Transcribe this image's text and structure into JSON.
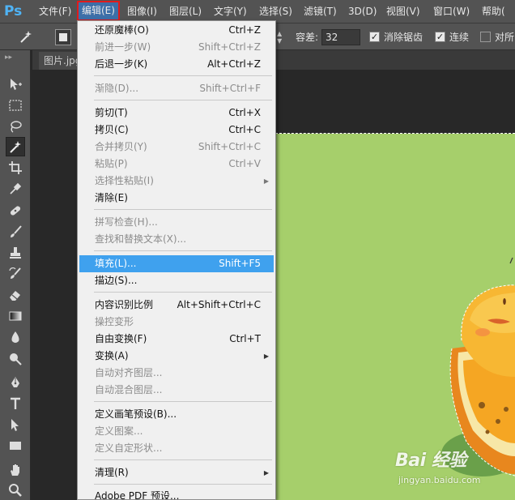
{
  "app": {
    "logo": "Ps",
    "menus": [
      "文件(F)",
      "编辑(E)",
      "图像(I)",
      "图层(L)",
      "文字(Y)",
      "选择(S)",
      "滤镜(T)",
      "3D(D)",
      "视图(V)",
      "窗口(W)",
      "帮助("
    ],
    "active_menu": "编辑(E)"
  },
  "options": {
    "tolerance_label": "容差:",
    "tolerance_value": "32",
    "antialias_label": "消除锯齿",
    "antialias_checked": true,
    "contiguous_label": "连续",
    "contiguous_checked": true,
    "sample_all_label": "对所",
    "sample_all_checked": false
  },
  "document": {
    "tab_title": "图片.jpg"
  },
  "edit_menu": {
    "items": [
      {
        "label": "还原魔棒(O)",
        "shortcut": "Ctrl+Z",
        "enabled": true
      },
      {
        "label": "前进一步(W)",
        "shortcut": "Shift+Ctrl+Z",
        "enabled": false
      },
      {
        "label": "后退一步(K)",
        "shortcut": "Alt+Ctrl+Z",
        "enabled": true
      },
      {
        "label": "渐隐(D)...",
        "shortcut": "Shift+Ctrl+F",
        "enabled": false
      },
      {
        "label": "剪切(T)",
        "shortcut": "Ctrl+X",
        "enabled": true
      },
      {
        "label": "拷贝(C)",
        "shortcut": "Ctrl+C",
        "enabled": true
      },
      {
        "label": "合并拷贝(Y)",
        "shortcut": "Shift+Ctrl+C",
        "enabled": false
      },
      {
        "label": "粘贴(P)",
        "shortcut": "Ctrl+V",
        "enabled": false
      },
      {
        "label": "选择性粘贴(I)",
        "shortcut": "",
        "enabled": false,
        "submenu": true
      },
      {
        "label": "清除(E)",
        "shortcut": "",
        "enabled": true
      },
      {
        "label": "拼写检查(H)...",
        "shortcut": "",
        "enabled": false
      },
      {
        "label": "查找和替换文本(X)...",
        "shortcut": "",
        "enabled": false
      },
      {
        "label": "填充(L)...",
        "shortcut": "Shift+F5",
        "enabled": true,
        "highlighted": true
      },
      {
        "label": "描边(S)...",
        "shortcut": "",
        "enabled": true
      },
      {
        "label": "内容识别比例",
        "shortcut": "Alt+Shift+Ctrl+C",
        "enabled": true
      },
      {
        "label": "操控变形",
        "shortcut": "",
        "enabled": false
      },
      {
        "label": "自由变换(F)",
        "shortcut": "Ctrl+T",
        "enabled": true
      },
      {
        "label": "变换(A)",
        "shortcut": "",
        "enabled": true,
        "submenu": true
      },
      {
        "label": "自动对齐图层...",
        "shortcut": "",
        "enabled": false
      },
      {
        "label": "自动混合图层...",
        "shortcut": "",
        "enabled": false
      },
      {
        "label": "定义画笔预设(B)...",
        "shortcut": "",
        "enabled": true
      },
      {
        "label": "定义图案...",
        "shortcut": "",
        "enabled": false
      },
      {
        "label": "定义自定形状...",
        "shortcut": "",
        "enabled": false
      },
      {
        "label": "清理(R)",
        "shortcut": "",
        "enabled": true,
        "submenu": true
      },
      {
        "label": "Adobe PDF 预设...",
        "shortcut": "",
        "enabled": true
      }
    ]
  },
  "tools": [
    "move-tool-icon",
    "marquee-tool-icon",
    "lasso-tool-icon",
    "magic-wand-tool-icon",
    "crop-tool-icon",
    "eyedropper-tool-icon",
    "healing-brush-tool-icon",
    "brush-tool-icon",
    "clone-stamp-tool-icon",
    "history-brush-tool-icon",
    "eraser-tool-icon",
    "gradient-tool-icon",
    "blur-tool-icon",
    "dodge-tool-icon",
    "pen-tool-icon",
    "type-tool-icon",
    "path-selection-tool-icon",
    "rectangle-tool-icon",
    "hand-tool-icon",
    "zoom-tool-icon"
  ],
  "watermark": {
    "brand": "Bai 经验",
    "url": "jingyan.baidu.com"
  },
  "colors": {
    "menu_bg": "#535353",
    "highlight": "#3fa1ee",
    "canvas_green": "#a6cf6b",
    "active_menu_border": "#e01b1b"
  }
}
